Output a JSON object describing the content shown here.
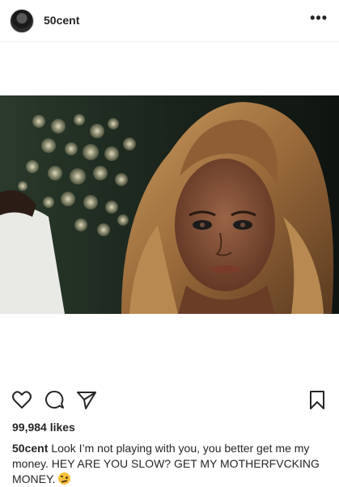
{
  "post": {
    "username": "50cent",
    "more_icon": "ellipsis-icon",
    "likes": "99,984 likes",
    "caption_user": "50cent",
    "caption_text": "Look I’m not playing with you, you better get me my money. HEY ARE YOU SLOW? GET MY MOTHERFVCKING MONEY.",
    "caption_emoji": "face-with-raised-eyebrow-emoji"
  },
  "actions": {
    "like_icon": "heart-icon",
    "comment_icon": "comment-icon",
    "share_icon": "paper-plane-icon",
    "save_icon": "bookmark-icon"
  },
  "colors": {
    "text": "#262626",
    "divider": "#efefef"
  }
}
